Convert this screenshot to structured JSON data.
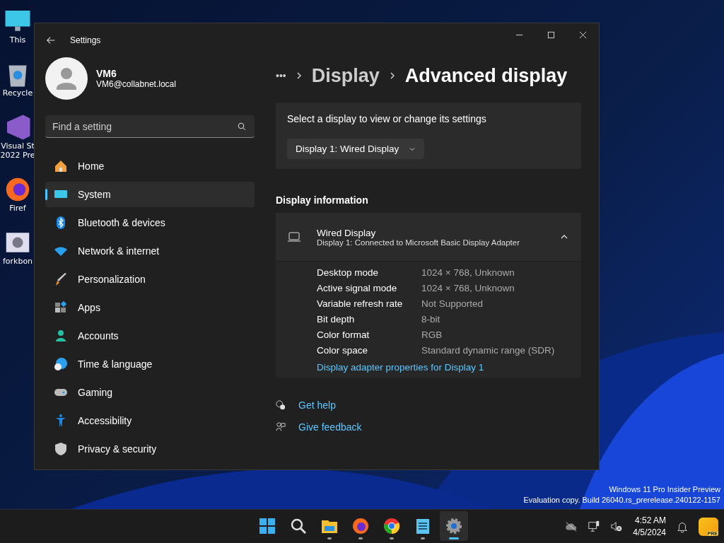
{
  "desktop": {
    "icons": [
      {
        "kind": "pc",
        "lines": [
          "This"
        ]
      },
      {
        "kind": "recycle",
        "lines": [
          "Recycle"
        ]
      },
      {
        "kind": "vs",
        "lines": [
          "Visual St",
          "2022 Pre"
        ]
      },
      {
        "kind": "firefox",
        "lines": [
          "Firef"
        ]
      },
      {
        "kind": "app",
        "lines": [
          "forkbon"
        ]
      }
    ]
  },
  "window": {
    "title": "Settings",
    "user": {
      "name": "VM6",
      "email": "VM6@collabnet.local"
    },
    "search": {
      "placeholder": "Find a setting"
    },
    "nav": [
      {
        "kind": "home",
        "label": "Home",
        "selected": false
      },
      {
        "kind": "system",
        "label": "System",
        "selected": true
      },
      {
        "kind": "bluetooth",
        "label": "Bluetooth & devices",
        "selected": false
      },
      {
        "kind": "network",
        "label": "Network & internet",
        "selected": false
      },
      {
        "kind": "brush",
        "label": "Personalization",
        "selected": false
      },
      {
        "kind": "apps",
        "label": "Apps",
        "selected": false
      },
      {
        "kind": "accounts",
        "label": "Accounts",
        "selected": false
      },
      {
        "kind": "time",
        "label": "Time & language",
        "selected": false
      },
      {
        "kind": "gaming",
        "label": "Gaming",
        "selected": false
      },
      {
        "kind": "accessibility",
        "label": "Accessibility",
        "selected": false
      },
      {
        "kind": "shield",
        "label": "Privacy & security",
        "selected": false
      }
    ],
    "breadcrumb": [
      {
        "kind": "ellipsis",
        "label": "•••"
      },
      {
        "kind": "parent",
        "label": "Display"
      },
      {
        "kind": "current",
        "label": "Advanced display"
      }
    ],
    "selector": {
      "prompt": "Select a display to view or change its settings",
      "value": "Display 1: Wired Display"
    },
    "section_title": "Display information",
    "info": {
      "title": "Wired Display",
      "subtitle": "Display 1: Connected to Microsoft Basic Display Adapter",
      "expanded": true,
      "rows": [
        {
          "label": "Desktop mode",
          "value": "1024 × 768, Unknown"
        },
        {
          "label": "Active signal mode",
          "value": "1024 × 768, Unknown"
        },
        {
          "label": "Variable refresh rate",
          "value": "Not Supported"
        },
        {
          "label": "Bit depth",
          "value": "8-bit"
        },
        {
          "label": "Color format",
          "value": "RGB"
        },
        {
          "label": "Color space",
          "value": "Standard dynamic range (SDR)"
        }
      ],
      "link": "Display adapter properties for Display 1"
    },
    "help": [
      {
        "kind": "help",
        "label": "Get help"
      },
      {
        "kind": "feedback",
        "label": "Give feedback"
      }
    ]
  },
  "watermark": [
    "Windows 11 Pro Insider Preview",
    "Evaluation copy. Build 26040.rs_prerelease.240122-1157"
  ],
  "taskbar": {
    "apps": [
      {
        "kind": "start",
        "running": false,
        "selected": false
      },
      {
        "kind": "search",
        "running": false,
        "selected": false
      },
      {
        "kind": "explorer",
        "running": true,
        "selected": false
      },
      {
        "kind": "firefox",
        "running": true,
        "selected": false
      },
      {
        "kind": "chrome",
        "running": true,
        "selected": false
      },
      {
        "kind": "notepad",
        "running": true,
        "selected": false
      },
      {
        "kind": "settings",
        "running": true,
        "selected": true
      }
    ],
    "clock": {
      "time": "4:52 AM",
      "date": "4/5/2024"
    },
    "badge": "PRE"
  }
}
